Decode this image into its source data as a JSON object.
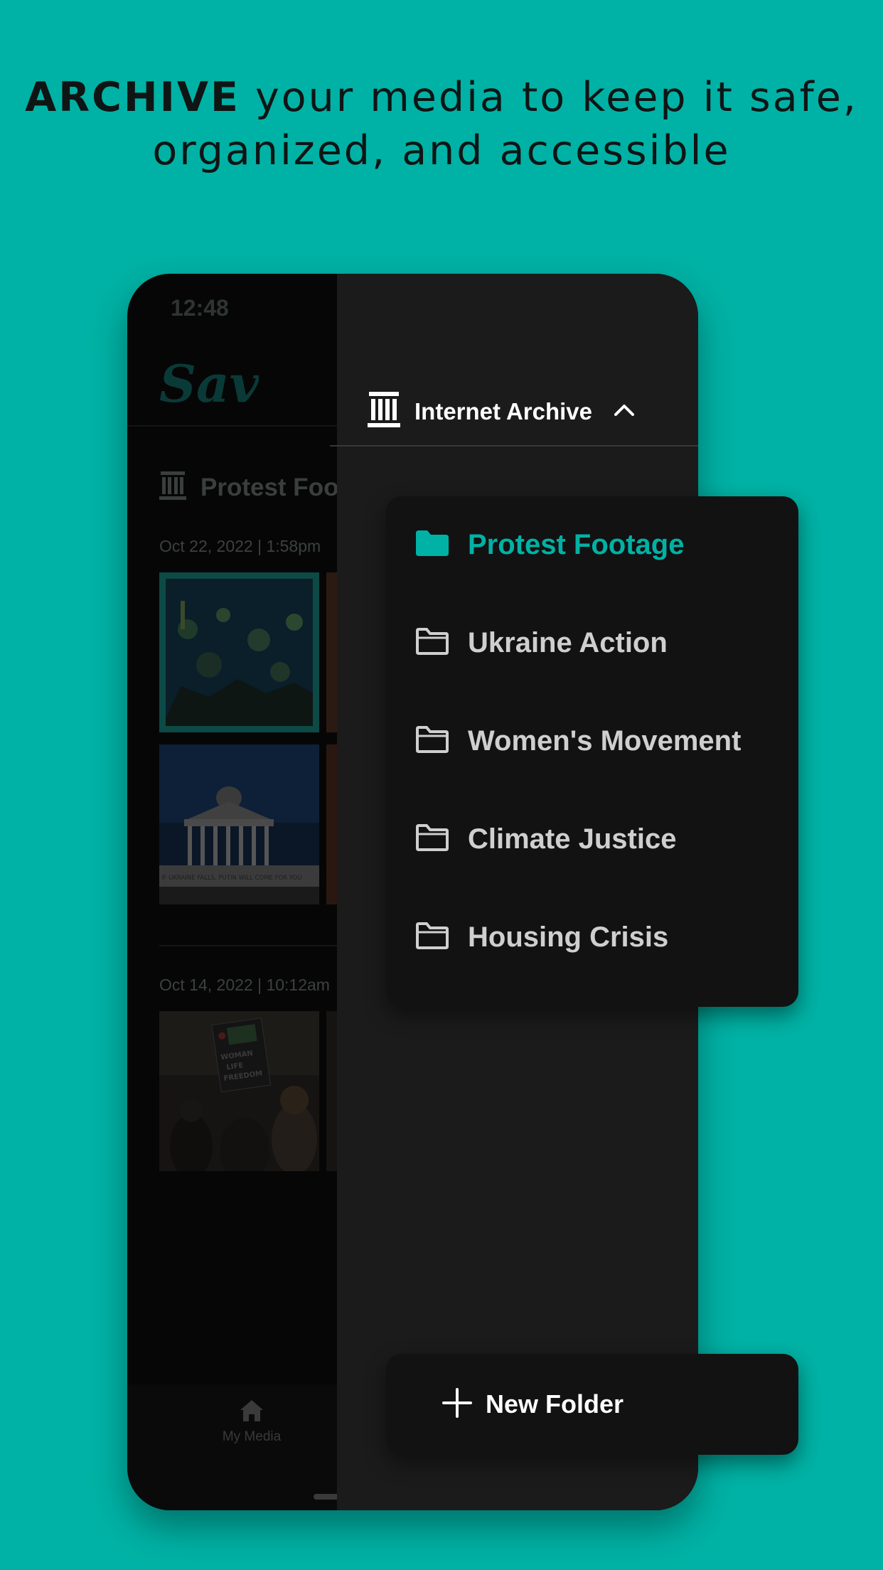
{
  "headline": {
    "bold": "ARCHIVE",
    "rest": " your media to keep it safe, organized, and accessible"
  },
  "app": {
    "status_time": "12:48",
    "logo_text": "Save",
    "page_title": "Protest Foo",
    "groups": [
      {
        "date": "Oct 22, 2022 | 1:58pm"
      },
      {
        "date": "Oct 14, 2022 | 10:12am"
      }
    ],
    "sign_lines": [
      "WOMAN",
      "LIFE",
      "FREEDOM"
    ],
    "banner_text": "IF UKRAINE FALLS, PUTIN WILL COME FOR YOU",
    "bottom_nav": {
      "my_media": "My Media"
    }
  },
  "drawer": {
    "server_label": "Internet Archive",
    "folders": [
      {
        "label": "Protest Footage",
        "active": true
      },
      {
        "label": "Ukraine Action",
        "active": false
      },
      {
        "label": "Women's Movement",
        "active": false
      },
      {
        "label": "Climate Justice",
        "active": false
      },
      {
        "label": "Housing Crisis",
        "active": false
      }
    ],
    "new_folder_label": "New Folder"
  },
  "colors": {
    "background": "#00b2a5",
    "accent": "#00b2a5",
    "drawer": "#1b1b1b",
    "card": "#121212"
  }
}
